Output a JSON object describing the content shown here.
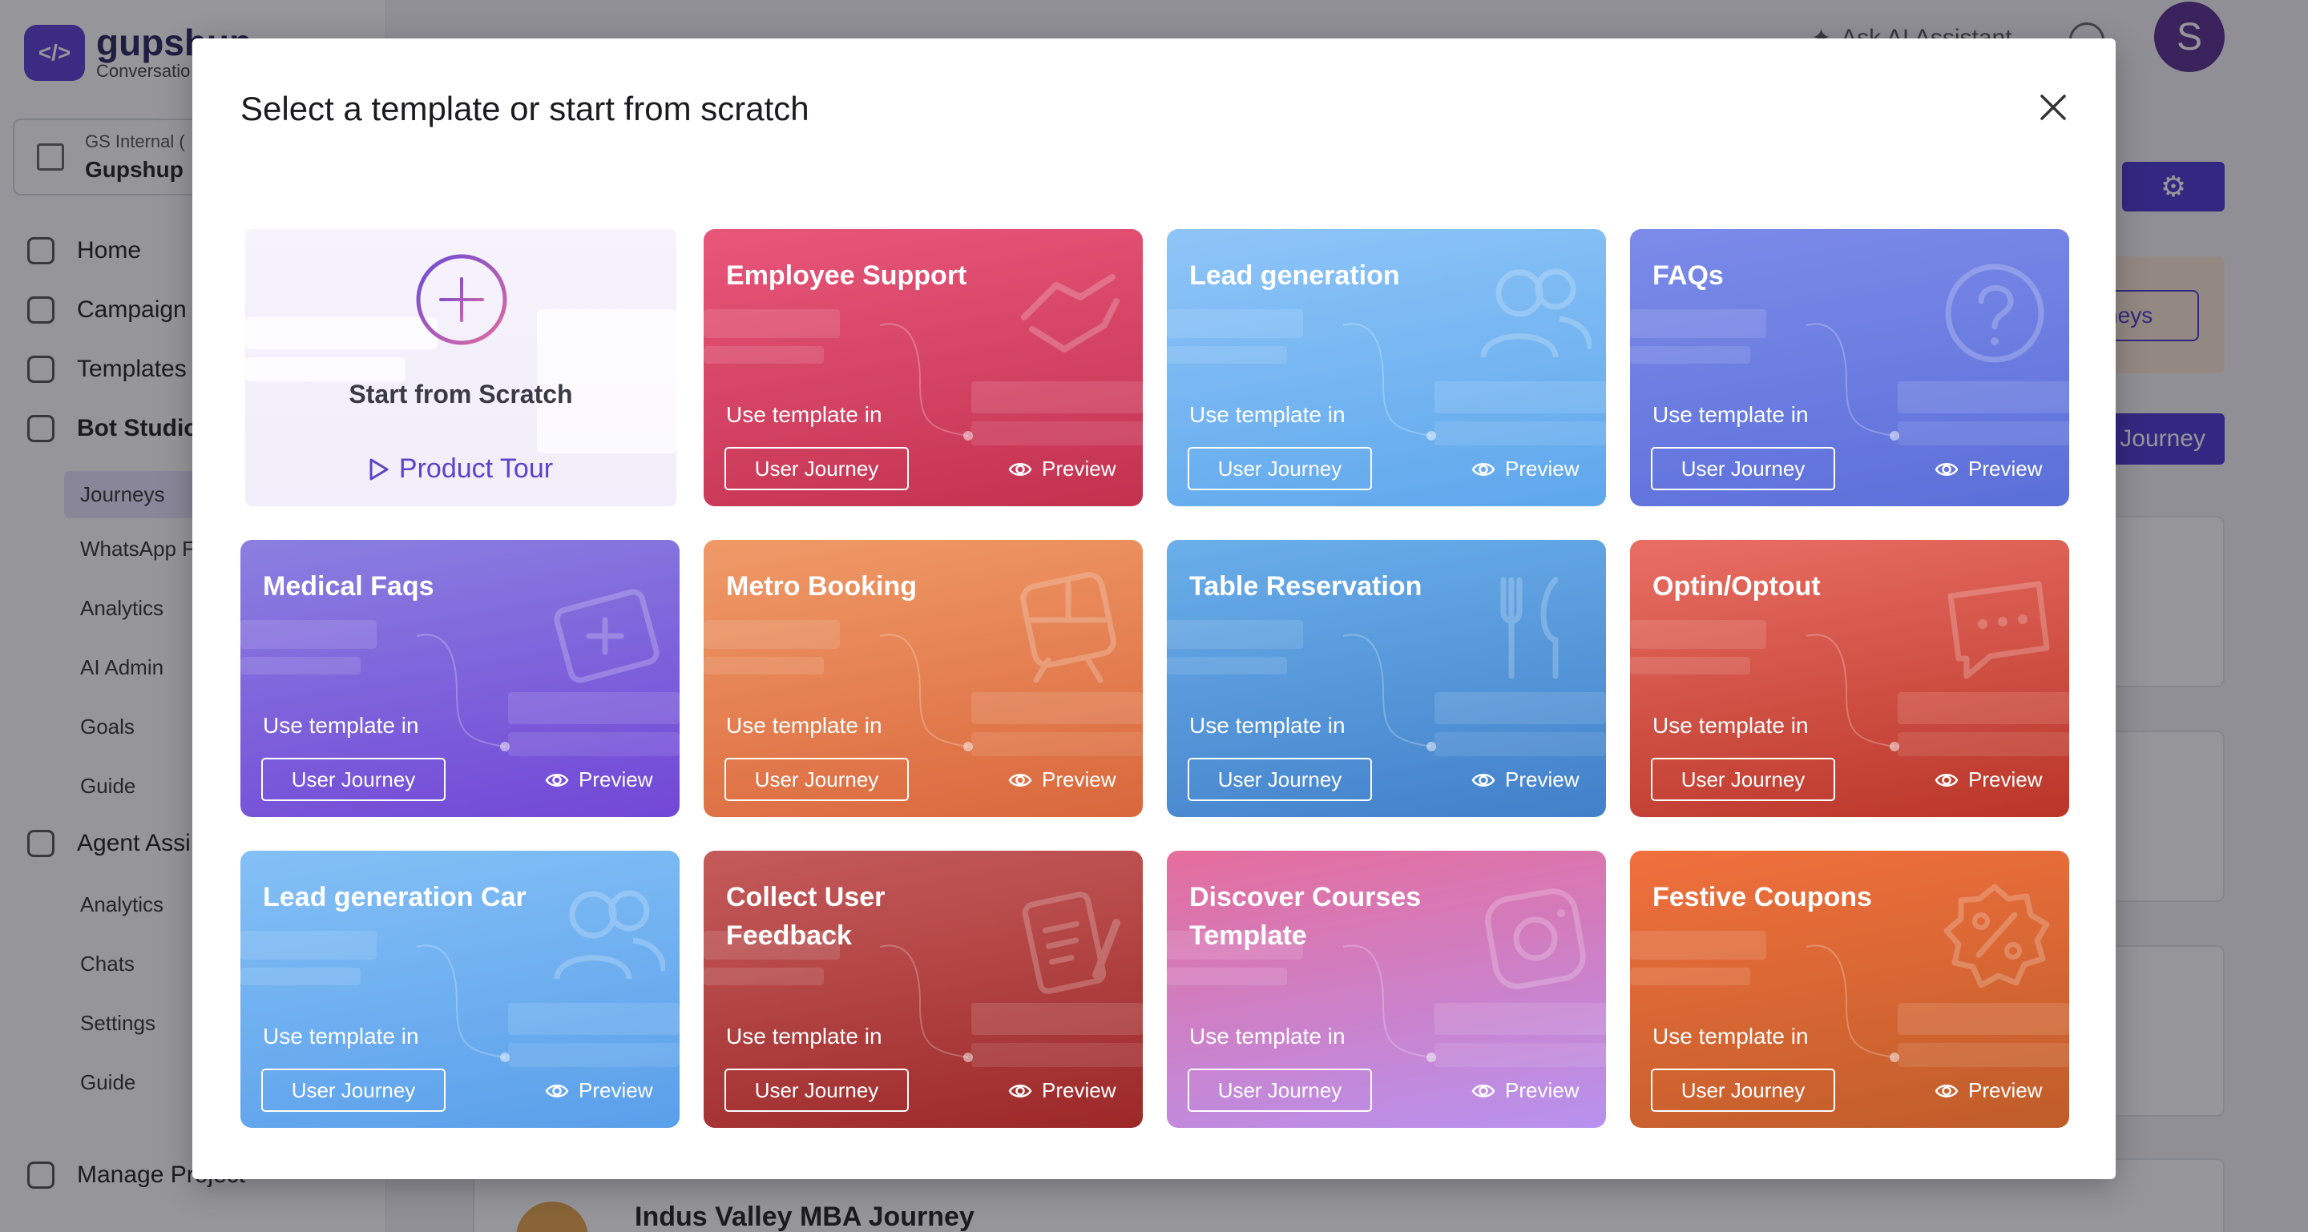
{
  "app": {
    "logo_name": "gupshup",
    "logo_sub": "Conversatio",
    "org_label": "GS Internal (",
    "org_name": "Gupshup",
    "nav": {
      "home": "Home",
      "campaigns": "Campaign",
      "templates": "Templates",
      "bot_studio": "Bot Studio",
      "journeys": "Journeys",
      "whatsapp": "WhatsApp F",
      "analytics": "Analytics",
      "ai_admin": "AI Admin",
      "goals": "Goals",
      "guide": "Guide",
      "agent_assist": "Agent Assi",
      "agent_analytics": "Analytics",
      "chats": "Chats",
      "settings": "Settings",
      "agent_guide": "Guide",
      "manage_project": "Manage Project"
    },
    "topbar": {
      "ai_assistant": "Ask AI Assistant",
      "avatar_initial": "S"
    },
    "bg": {
      "journeys_btn": "rneys",
      "create_btn": "Journey",
      "row_title": "Indus Valley MBA Journey"
    }
  },
  "modal": {
    "title": "Select a template or start from scratch",
    "scratch": {
      "label": "Start from Scratch",
      "tour": "Product Tour"
    },
    "use_label": "Use template in",
    "uj_label": "User Journey",
    "preview_label": "Preview",
    "cards": [
      {
        "title": "Employee Support",
        "icon": "handshake-icon",
        "grad": [
          "#e8567a",
          "#c2324f"
        ]
      },
      {
        "title": "Lead generation",
        "icon": "users-icon",
        "grad": [
          "#8ec5f8",
          "#5ea7ec"
        ]
      },
      {
        "title": "FAQs",
        "icon": "question-icon",
        "grad": [
          "#7c8be9",
          "#5b6fd9"
        ]
      },
      {
        "title": "Medical Faqs",
        "icon": "medical-kit-icon",
        "grad": [
          "#8a7fe0",
          "#7247d6"
        ]
      },
      {
        "title": "Metro Booking",
        "icon": "train-icon",
        "grad": [
          "#f09a68",
          "#d9673c"
        ]
      },
      {
        "title": "Table Reservation",
        "icon": "cutlery-icon",
        "grad": [
          "#6aaeea",
          "#4280c9"
        ]
      },
      {
        "title": "Optin/Optout",
        "icon": "chat-bubble-icon",
        "grad": [
          "#e96e63",
          "#b93528"
        ]
      },
      {
        "title": "Lead generation Car",
        "icon": "users-icon",
        "grad": [
          "#83c0f6",
          "#5a9fea"
        ]
      },
      {
        "title": "Collect User Feedback",
        "icon": "clipboard-pen-icon",
        "grad": [
          "#c55b5b",
          "#9c2828"
        ]
      },
      {
        "title": "Discover Courses Template",
        "icon": "camera-icon",
        "grad": [
          "#e56d9c",
          "#b792ef"
        ]
      },
      {
        "title": "Festive Coupons",
        "icon": "discount-badge-icon",
        "grad": [
          "#f0703d",
          "#bf5d2a"
        ]
      }
    ]
  }
}
